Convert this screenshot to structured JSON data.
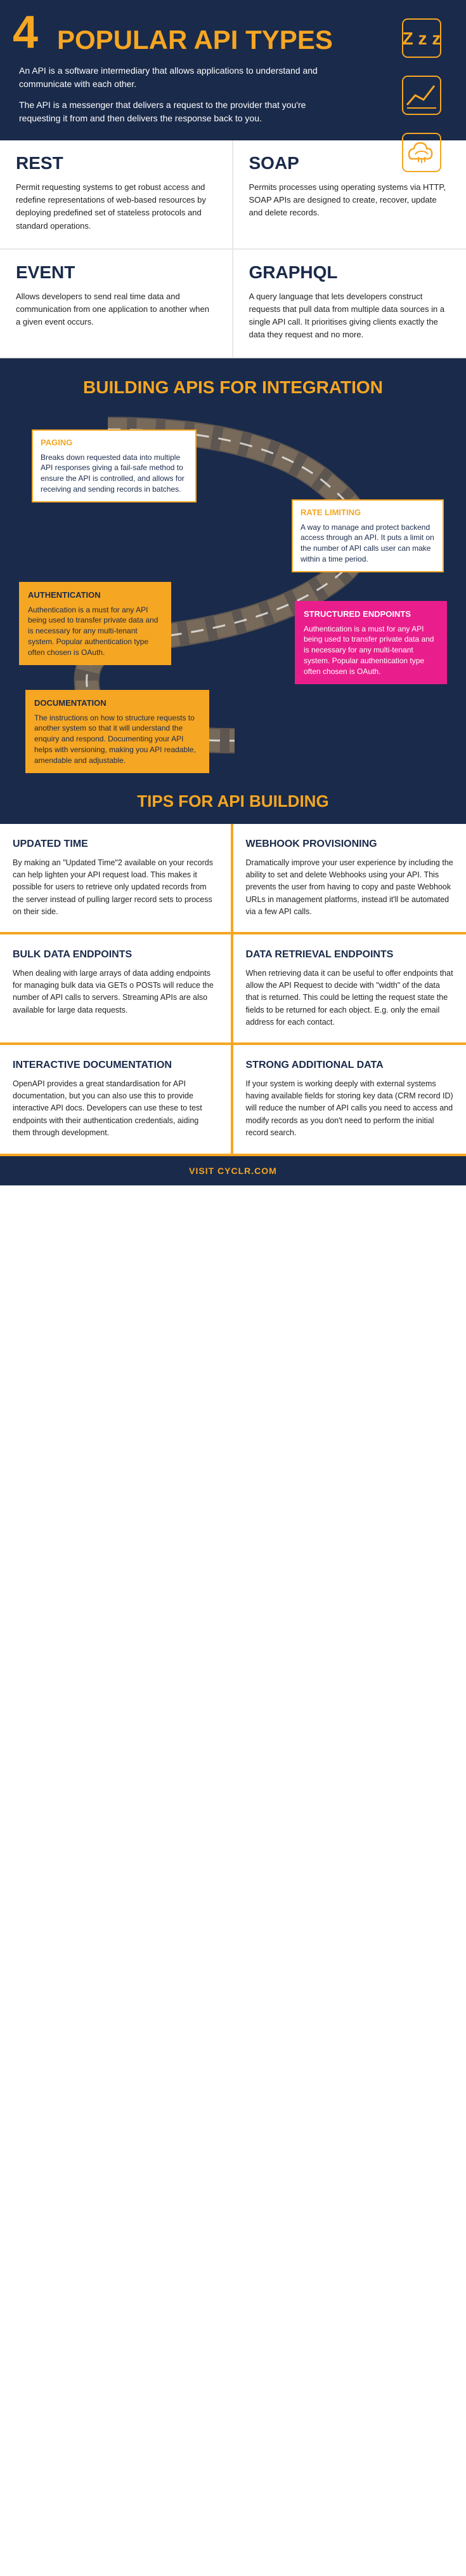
{
  "header": {
    "number": "4",
    "title": "POPULAR API TYPES",
    "desc1": "An API is a software intermediary that allows applications to understand and communicate with each other.",
    "desc2": "The API is a messenger that delivers a request to the provider that you're requesting it from and then delivers the response back to you."
  },
  "api_types": [
    {
      "title": "REST",
      "desc": "Permit requesting systems to get robust access and redefine representations of web-based resources by deploying predefined set of stateless protocols and standard operations."
    },
    {
      "title": "SOAP",
      "desc": "Permits processes using operating systems via HTTP, SOAP APIs are designed to create, recover, update and delete records."
    },
    {
      "title": "EVENT",
      "desc": "Allows developers to send real time data and communication from one application to another when a given event occurs."
    },
    {
      "title": "GraphQL",
      "desc": "A query language that lets developers construct requests that pull data from multiple data sources in a single API call. It prioritises giving clients exactly the data they request and no more."
    }
  ],
  "building": {
    "section_title": "BUILDING APIs FOR INTEGRATION",
    "paging": {
      "title": "PAGING",
      "desc": "Breaks down requested data into multiple API responses giving a fail-safe method to ensure the API is controlled, and allows for receiving and sending records in batches."
    },
    "rate_limiting": {
      "title": "RATE LIMITING",
      "desc": "A way to manage and protect backend access through an API. It puts a limit on the number of API calls user can make within a time period."
    },
    "authentication": {
      "title": "AUTHENTICATION",
      "desc": "Authentication is a must for any API being used to transfer private data and is necessary for any multi-tenant system. Popular authentication type often chosen is OAuth."
    },
    "structured_endpoints": {
      "title": "STRUCTURED ENDPOINTS",
      "desc": "Authentication is a must for any API being used to transfer private data and is necessary for any multi-tenant system. Popular authentication type often chosen is OAuth."
    },
    "documentation": {
      "title": "DOCUMENTATION",
      "desc": "The instructions on how to structure requests to another system so that it will understand the enquiry and respond. Documenting your API helps with versioning, making you API readable, amendable and adjustable."
    }
  },
  "tips": {
    "section_title": "TIPS FOR API BUILDING",
    "items": [
      {
        "title": "UPDATED TIME",
        "desc": "By making an \"Updated Time\"2 available on your records can help lighten your API request load. This makes it possible for users to retrieve only updated records from the server instead of pulling larger record sets to process on their side.",
        "highlighted": false
      },
      {
        "title": "WEBHOOK PROVISIONING",
        "desc": "Dramatically improve your user experience by including the ability to set and delete Webhooks using your API. This prevents the user from having to copy and paste Webhook URLs in management platforms, instead it'll be automated via a few API calls.",
        "highlighted": false
      },
      {
        "title": "BULK DATA ENDPOINTS",
        "desc": "When dealing with large arrays of data adding endpoints for managing bulk data via GETs o POSTs will reduce the number of API calls to servers. Streaming APIs are also available for large data requests.",
        "highlighted": false
      },
      {
        "title": "DATA RETRIEVAL ENDPOINTS",
        "desc": "When retrieving data it can be useful to offer endpoints that allow the API Request to decide with \"width\" of the data that is returned. This could be letting the request state the fields to be returned for each object. E.g. only the email address for each contact.",
        "highlighted": false
      },
      {
        "title": "INTERACTIVE DOCUMENTATION",
        "desc": "OpenAPI provides a great standardisation for API documentation, but you can also use this to provide interactive API docs. Developers can use these to test endpoints with their authentication credentials, aiding them through development.",
        "highlighted": false
      },
      {
        "title": "STRONG ADDITIONAL DATA",
        "desc": "If your system is working deeply with external systems having available fields for storing key data (CRM record ID) will reduce the number of API calls you need to access and modify records as you don't need to perform the initial record search.",
        "highlighted": false
      }
    ]
  },
  "footer": {
    "text": "VISIT CYCLR.COM"
  }
}
